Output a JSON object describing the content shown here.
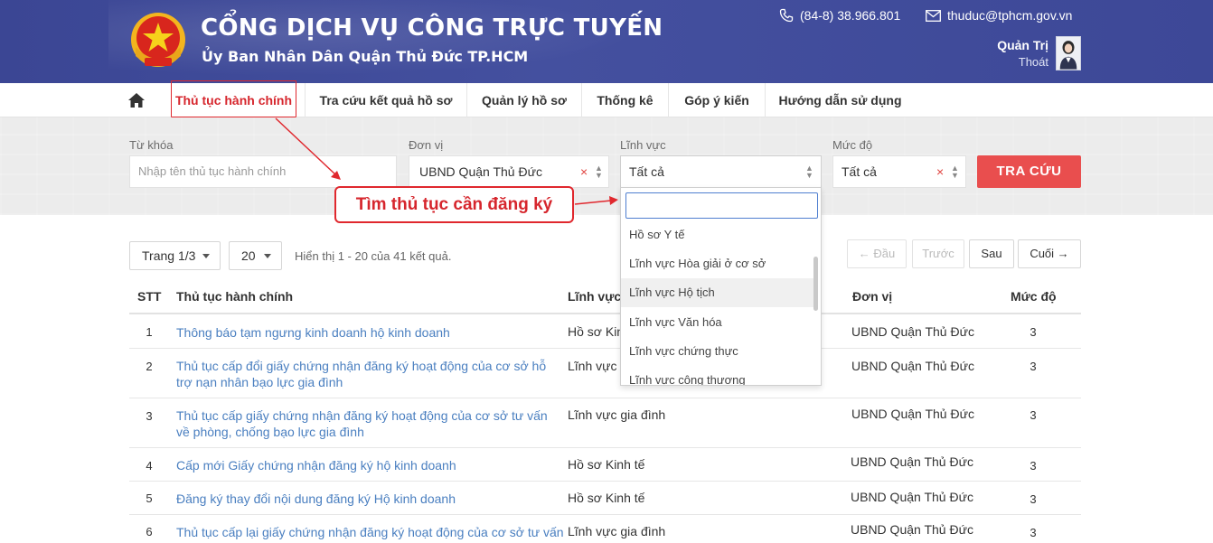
{
  "header": {
    "title": "CỔNG DỊCH VỤ CÔNG TRỰC TUYẾN",
    "subtitle": "Ủy Ban Nhân Dân Quận Thủ Đức TP.HCM",
    "phone": "(84-8) 38.966.801",
    "email": "thuduc@tphcm.gov.vn",
    "user_name": "Quản Trị",
    "logout": "Thoát"
  },
  "nav": {
    "items": [
      {
        "label": "Thủ tục hành chính"
      },
      {
        "label": "Tra cứu kết quả hồ sơ"
      },
      {
        "label": "Quản lý hồ sơ"
      },
      {
        "label": "Thống kê"
      },
      {
        "label": "Góp ý kiến"
      },
      {
        "label": "Hướng dẫn sử dụng"
      }
    ]
  },
  "search": {
    "keyword_label": "Từ khóa",
    "keyword_placeholder": "Nhập tên thủ tục hành chính",
    "unit_label": "Đơn vị",
    "unit_value": "UBND Quận Thủ Đức",
    "field_label": "Lĩnh vực",
    "field_value": "Tất cả",
    "level_label": "Mức độ",
    "level_value": "Tất cả",
    "submit_label": "TRA CỨU"
  },
  "dropdown": {
    "options": [
      "Hồ sơ Y tế",
      "Lĩnh vực Hòa giải ở cơ sở",
      "Lĩnh vực Hộ tịch",
      "Lĩnh vực Văn hóa",
      "Lĩnh vực chứng thực",
      "Lĩnh vực công thương"
    ]
  },
  "callout": {
    "text": "Tìm thủ tục cần đăng ký"
  },
  "pager": {
    "page_select": "Trang 1/3",
    "size_select": "20",
    "result_info": "Hiển thị 1 - 20 của 41 kết quả.",
    "first": "← Đầu",
    "prev": "Trước",
    "next": "Sau",
    "last": "Cuối →"
  },
  "table": {
    "headers": {
      "stt": "STT",
      "name": "Thủ tục hành chính",
      "field": "Lĩnh vực",
      "unit": "Đơn vị",
      "level": "Mức độ"
    },
    "rows": [
      {
        "stt": "1",
        "name": "Thông báo tạm ngưng kinh doanh hộ kinh doanh",
        "field": "Hồ sơ Kinh tế",
        "unit": "UBND Quận Thủ Đức",
        "level": "3"
      },
      {
        "stt": "2",
        "name": "Thủ tục cấp đổi giấy chứng nhận đăng ký hoạt động của cơ sở hỗ trợ nạn nhân bạo lực gia đình",
        "field": "Lĩnh vực gia đình",
        "unit": "UBND Quận Thủ Đức",
        "level": "3"
      },
      {
        "stt": "3",
        "name": "Thủ tục cấp giấy chứng nhận đăng ký hoạt động của cơ sở tư vấn về phòng, chống bạo lực gia đình",
        "field": "Lĩnh vực gia đình",
        "unit": "UBND Quận Thủ Đức",
        "level": "3"
      },
      {
        "stt": "4",
        "name": "Cấp mới Giấy chứng nhận đăng ký hộ kinh doanh",
        "field": "Hồ sơ Kinh tế",
        "unit": "UBND Quận Thủ Đức",
        "level": "3"
      },
      {
        "stt": "5",
        "name": "Đăng ký thay đổi nội dung đăng ký Hộ kinh doanh",
        "field": "Hồ sơ Kinh tế",
        "unit": "UBND Quận Thủ Đức",
        "level": "3"
      },
      {
        "stt": "6",
        "name": "Thủ tục cấp lại giấy chứng nhận đăng ký hoạt động của cơ sở tư vấn về",
        "field": "Lĩnh vực gia đình",
        "unit": "UBND Quận Thủ Đức",
        "level": "3"
      }
    ]
  },
  "colors": {
    "header_bg": "#3f4a9a",
    "accent_red": "#e0282e",
    "button_red": "#e94e4e",
    "link_blue": "#4a7fc0"
  }
}
